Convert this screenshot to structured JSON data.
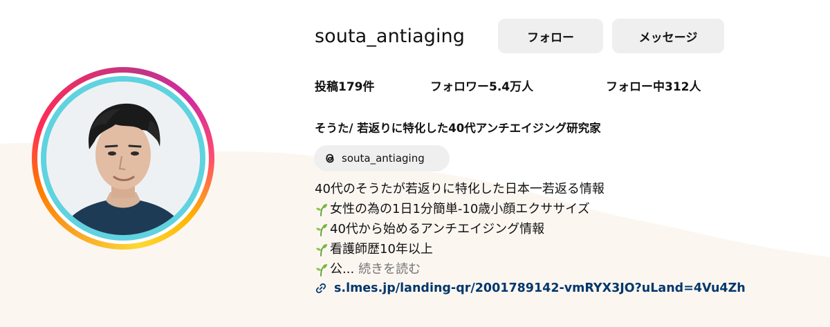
{
  "profile": {
    "username": "souta_antiaging",
    "follow_label": "フォロー",
    "message_label": "メッセージ"
  },
  "stats": {
    "posts": "投稿179件",
    "followers": "フォロワー5.4万人",
    "following": "フォロー中312人"
  },
  "bio": {
    "full_name": "そうた/ 若返りに特化した40代アンチエイジング研究家",
    "threads_handle": "souta_antiaging",
    "lines": [
      "40代のそうたが若返りに特化した日本一若返る情報",
      "女性の為の1日1分簡単-10歳小顔エクササイズ",
      "40代から始めるアンチエイジング情報",
      "看護師歴10年以上",
      "公..."
    ],
    "more_label": "続きを読む",
    "link": "s.lmes.jp/landing-qr/2001789142-vmRYX3JO?uLand=4Vu4Zh"
  },
  "icons": {
    "threads": "threads-icon",
    "sprout": "seedling-icon",
    "link": "link-icon"
  },
  "colors": {
    "link": "#00376b",
    "button_bg": "#efefef",
    "avatar_ring_inner": "#5fd3df",
    "muted_text": "#737373",
    "background_wave": "#fcf6f1"
  }
}
